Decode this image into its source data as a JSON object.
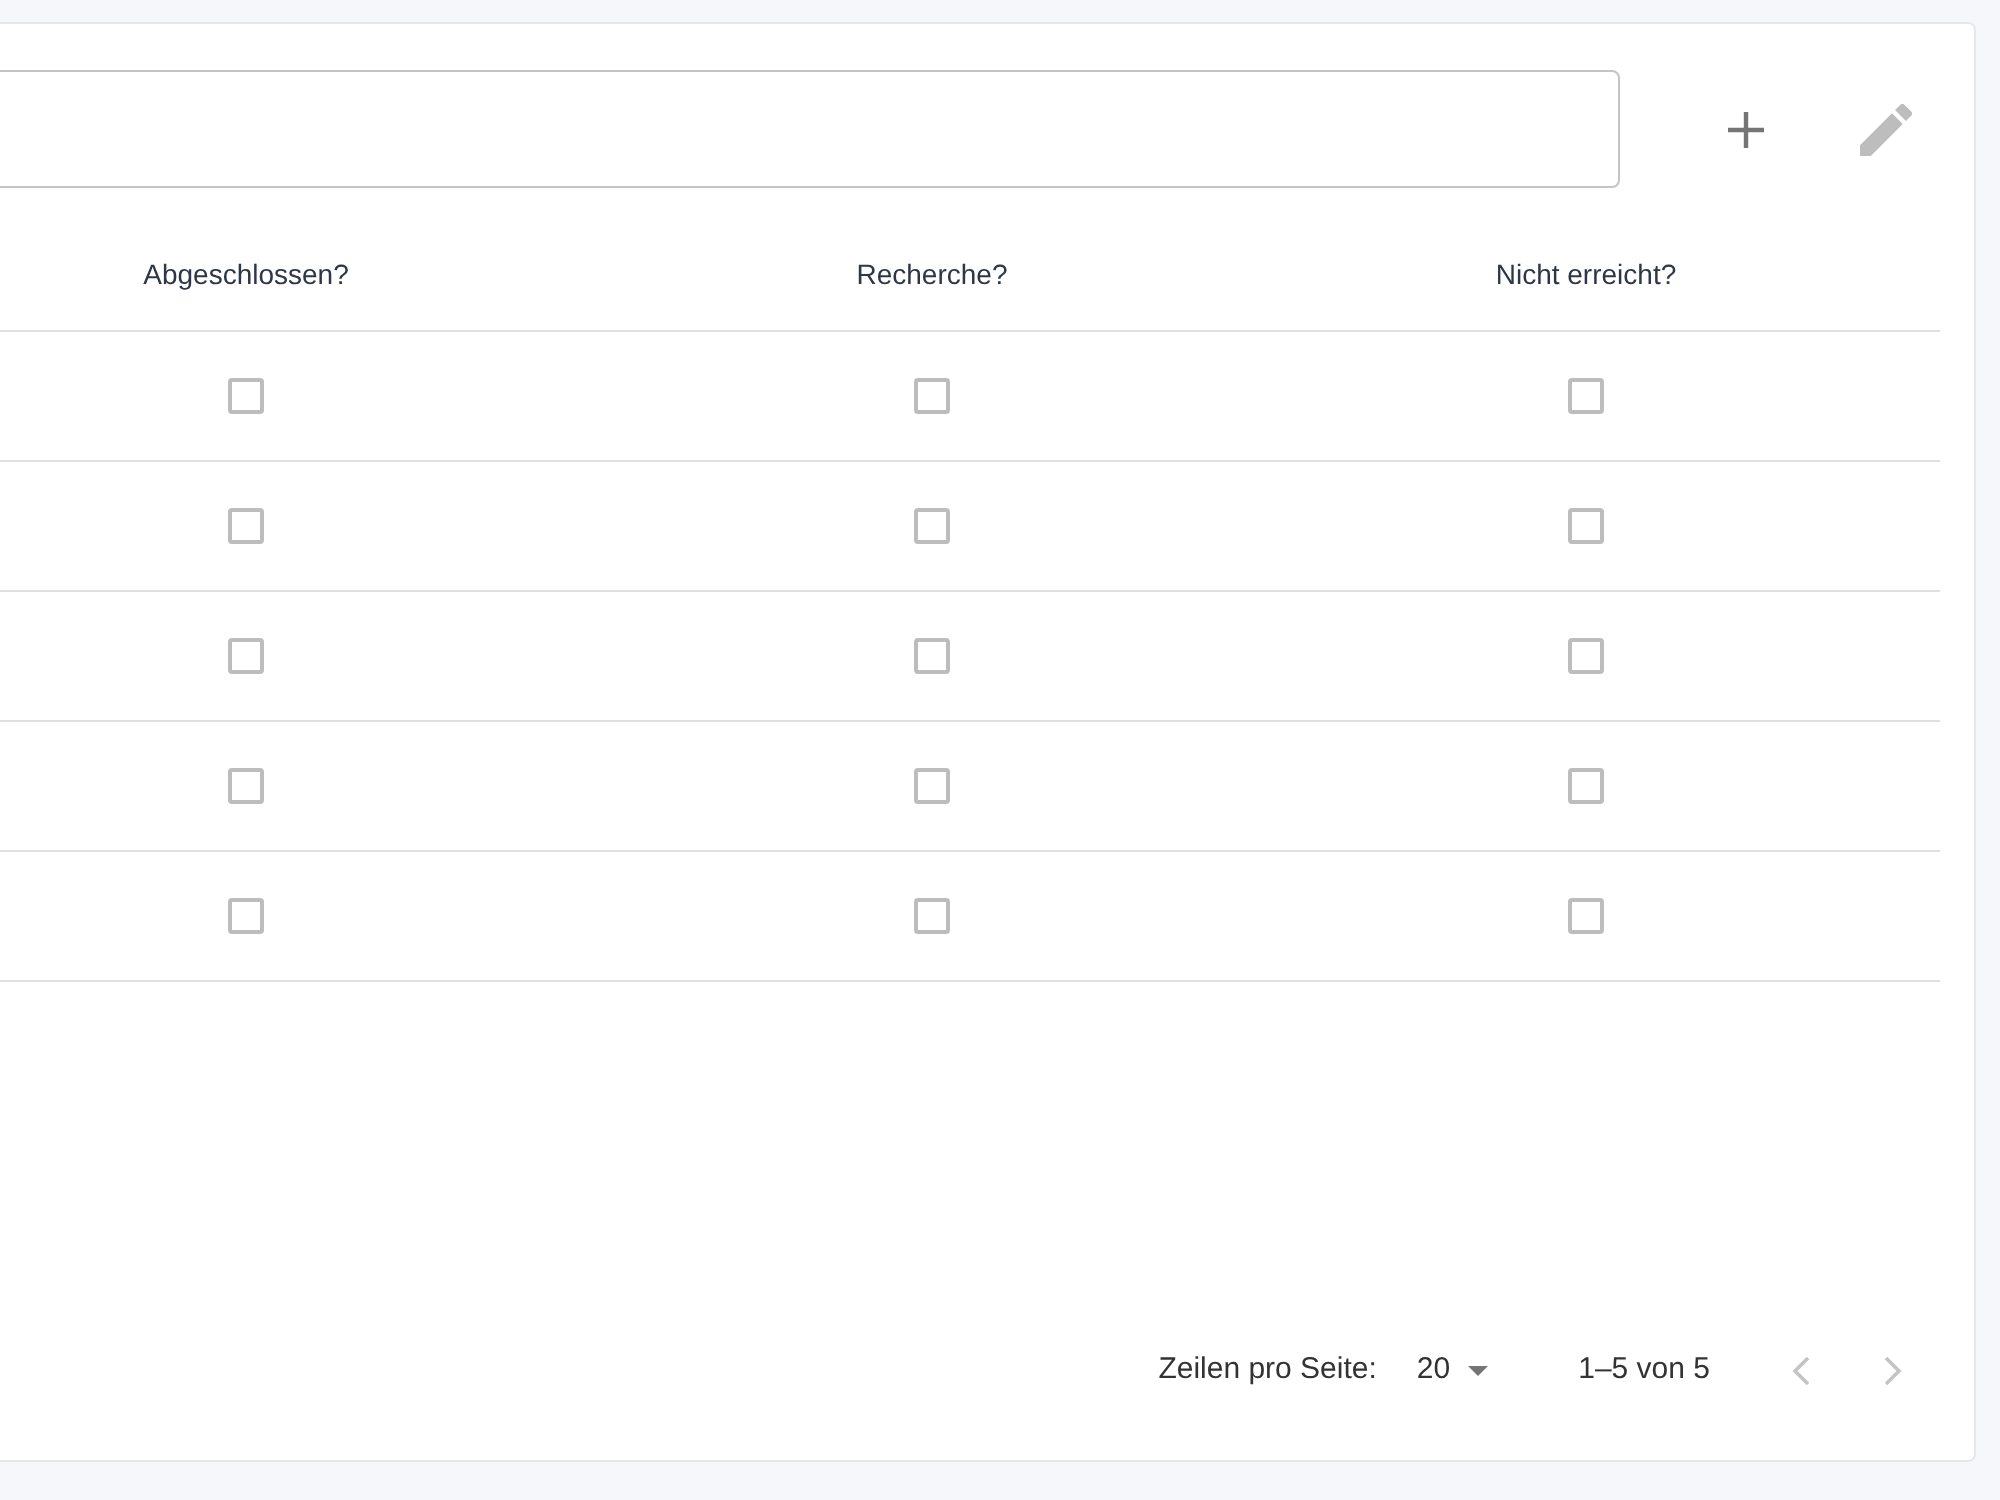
{
  "toolbar": {
    "buttons": [
      {
        "kind": "add",
        "disabled": false
      },
      {
        "kind": "edit",
        "disabled": true
      }
    ]
  },
  "table": {
    "columns": [
      "Abgeschlossen?",
      "Recherche?",
      "Nicht erreicht?"
    ],
    "rows": [
      {
        "cells": [
          {
            "checked": false
          },
          {
            "checked": false
          },
          {
            "checked": false
          }
        ]
      },
      {
        "cells": [
          {
            "checked": false
          },
          {
            "checked": false
          },
          {
            "checked": false
          }
        ]
      },
      {
        "cells": [
          {
            "checked": false
          },
          {
            "checked": false
          },
          {
            "checked": false
          }
        ]
      },
      {
        "cells": [
          {
            "checked": false
          },
          {
            "checked": false
          },
          {
            "checked": false
          }
        ]
      },
      {
        "cells": [
          {
            "checked": false
          },
          {
            "checked": false
          },
          {
            "checked": false
          }
        ]
      }
    ]
  },
  "pagination": {
    "rows_per_page_label": "Zeilen pro Seite:",
    "rows_per_page": "20",
    "range": "1–5 von 5",
    "buttons": [
      {
        "kind": "prev",
        "disabled": true
      },
      {
        "kind": "next",
        "disabled": true
      }
    ]
  }
}
